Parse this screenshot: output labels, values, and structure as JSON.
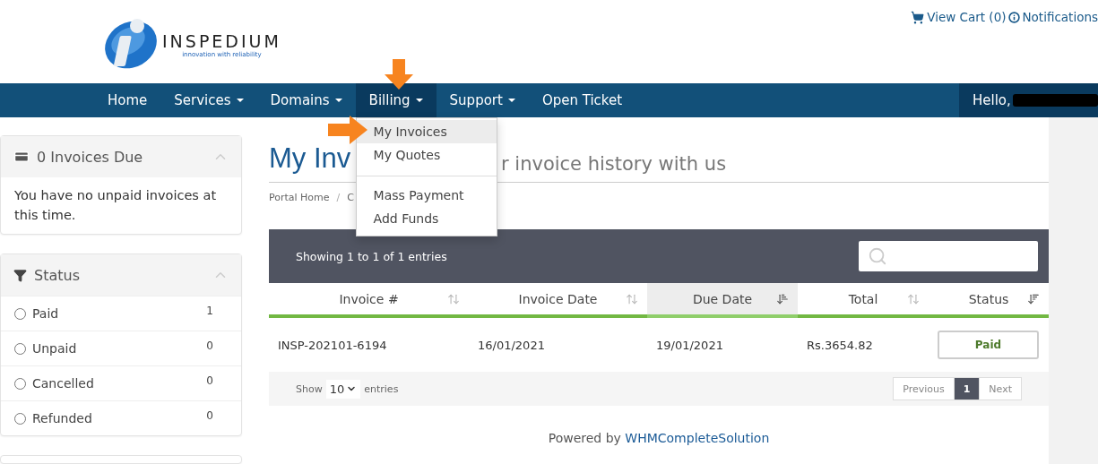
{
  "brand": {
    "name": "INSPEDIUM",
    "tagline": "innovation with reliability"
  },
  "top_links": [
    {
      "kind": "cart",
      "label": "View Cart (0)"
    },
    {
      "kind": "info",
      "label": "Notifications"
    }
  ],
  "nav": {
    "items": [
      {
        "label": "Home",
        "has_menu": false,
        "selected": false
      },
      {
        "label": "Services",
        "has_menu": true,
        "selected": false
      },
      {
        "label": "Domains",
        "has_menu": true,
        "selected": false
      },
      {
        "label": "Billing",
        "has_menu": true,
        "selected": true
      },
      {
        "label": "Support",
        "has_menu": true,
        "selected": false
      },
      {
        "label": "Open Ticket",
        "has_menu": false,
        "selected": false
      }
    ],
    "greeting": "Hello,",
    "menu": [
      {
        "kind": "item",
        "label": "My Invoices",
        "selected": true
      },
      {
        "kind": "item",
        "label": "My Quotes",
        "selected": false
      },
      {
        "kind": "divider"
      },
      {
        "kind": "item",
        "label": "Mass Payment",
        "selected": false
      },
      {
        "kind": "item",
        "label": "Add Funds",
        "selected": false
      }
    ]
  },
  "sidebar": {
    "due_panel": {
      "title": "0 Invoices Due",
      "expanded": true,
      "text": "You have no unpaid invoices at this time."
    },
    "status_panel": {
      "title": "Status",
      "expanded": true,
      "items": [
        {
          "label": "Paid",
          "count": "1",
          "selected": false
        },
        {
          "label": "Unpaid",
          "count": "0",
          "selected": false
        },
        {
          "label": "Cancelled",
          "count": "0",
          "selected": false
        },
        {
          "label": "Refunded",
          "count": "0",
          "selected": false
        }
      ]
    }
  },
  "page": {
    "title_visible": "My Inv",
    "subtitle_visible": "r invoice history with us",
    "breadcrumb": [
      "Portal Home",
      "C"
    ],
    "breadcrumb_separator": "/"
  },
  "table": {
    "info": "Showing 1 to 1 of 1 entries",
    "columns": [
      {
        "label": "Invoice #",
        "kind": "plain",
        "selected": false
      },
      {
        "label": "Invoice Date",
        "kind": "plain",
        "selected": false
      },
      {
        "label": "Due Date",
        "kind": "ascending",
        "selected": true
      },
      {
        "label": "Total",
        "kind": "plain",
        "selected": false
      },
      {
        "label": "Status",
        "kind": "descending",
        "selected": false
      }
    ],
    "rows": [
      {
        "invoice": "INSP-202101-6194",
        "invoice_date": "16/01/2021",
        "due_date": "19/01/2021",
        "total": "Rs.3654.82",
        "status": "Paid"
      }
    ],
    "length": {
      "show": "Show",
      "value": "10",
      "entries": "entries"
    },
    "pagination": [
      {
        "label": "Previous",
        "selected": false
      },
      {
        "label": "1",
        "selected": true
      },
      {
        "label": "Next",
        "selected": false
      }
    ]
  },
  "footer": {
    "prefix": "Powered by",
    "link": "WHMCompleteSolution"
  }
}
